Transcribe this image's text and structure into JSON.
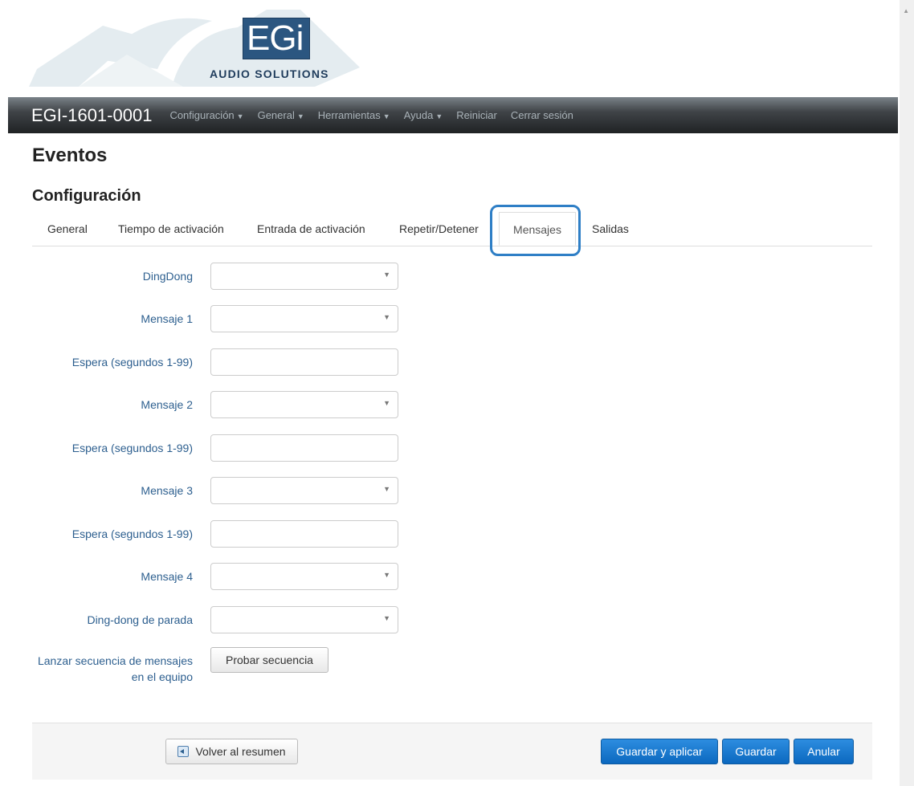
{
  "header": {
    "logo_text": "EGi",
    "logo_subtitle": "AUDIO SOLUTIONS"
  },
  "navbar": {
    "brand": "EGI-1601-0001",
    "items": [
      {
        "label": "Configuración",
        "dropdown": true
      },
      {
        "label": "General",
        "dropdown": true
      },
      {
        "label": "Herramientas",
        "dropdown": true
      },
      {
        "label": "Ayuda",
        "dropdown": true
      },
      {
        "label": "Reiniciar",
        "dropdown": false
      },
      {
        "label": "Cerrar sesión",
        "dropdown": false
      }
    ]
  },
  "page": {
    "title": "Eventos",
    "section_title": "Configuración"
  },
  "tabs": [
    {
      "label": "General",
      "active": false
    },
    {
      "label": "Tiempo de activación",
      "active": false
    },
    {
      "label": "Entrada de activación",
      "active": false
    },
    {
      "label": "Repetir/Detener",
      "active": false
    },
    {
      "label": "Mensajes",
      "active": true
    },
    {
      "label": "Salidas",
      "active": false
    }
  ],
  "form": {
    "fields": [
      {
        "label": "DingDong",
        "type": "select",
        "value": ""
      },
      {
        "label": "Mensaje 1",
        "type": "select",
        "value": ""
      },
      {
        "label": "Espera (segundos 1-99)",
        "type": "text",
        "value": ""
      },
      {
        "label": "Mensaje 2",
        "type": "select",
        "value": ""
      },
      {
        "label": "Espera (segundos 1-99)",
        "type": "text",
        "value": ""
      },
      {
        "label": "Mensaje 3",
        "type": "select",
        "value": ""
      },
      {
        "label": "Espera (segundos 1-99)",
        "type": "text",
        "value": ""
      },
      {
        "label": "Mensaje 4",
        "type": "select",
        "value": ""
      },
      {
        "label": "Ding-dong de parada",
        "type": "select",
        "value": ""
      }
    ],
    "sequence_label": "Lanzar secuencia de mensajes en el equipo",
    "sequence_label_line1": "Lanzar secuencia de mensajes",
    "sequence_label_line2": "en el equipo",
    "test_button": "Probar secuencia"
  },
  "footer": {
    "back_button": "Volver al resumen",
    "save_apply_button": "Guardar y aplicar",
    "save_button": "Guardar",
    "cancel_button": "Anular"
  },
  "colors": {
    "primary": "#0b68bf",
    "label": "#2d5f8f",
    "highlight": "#2f7fc6",
    "navbar": "#2e3235"
  }
}
